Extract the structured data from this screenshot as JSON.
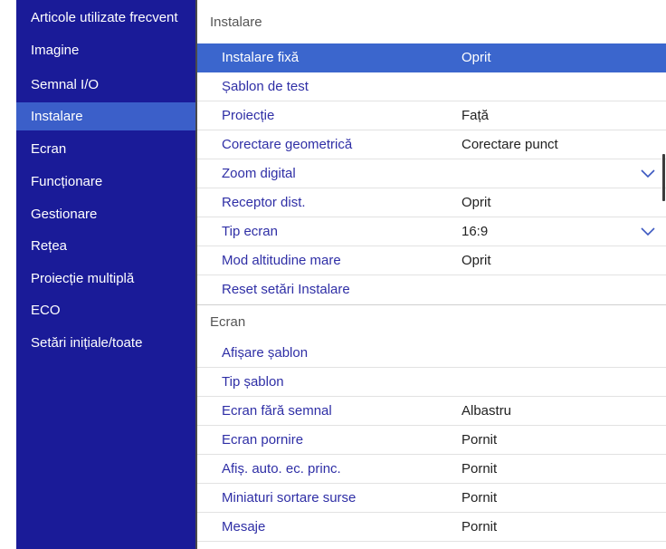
{
  "sidebar": {
    "items": [
      {
        "label": "Articole utilizate frecvent"
      },
      {
        "label": "Imagine"
      },
      {
        "label": "Semnal I/O"
      },
      {
        "label": "Instalare"
      },
      {
        "label": "Ecran"
      },
      {
        "label": "Funcționare"
      },
      {
        "label": "Gestionare"
      },
      {
        "label": "Rețea"
      },
      {
        "label": "Proiecție multiplă"
      },
      {
        "label": "ECO"
      },
      {
        "label": "Setări inițiale/toate"
      }
    ],
    "active_item": "Instalare"
  },
  "sections": [
    {
      "title": "Instalare",
      "rows": [
        {
          "label": "Instalare fixă",
          "value": "Oprit"
        },
        {
          "label": "Șablon de test",
          "value": ""
        },
        {
          "label": "Proiecție",
          "value": "Față"
        },
        {
          "label": "Corectare geometrică",
          "value": "Corectare punct"
        },
        {
          "label": "Zoom digital",
          "value": ""
        },
        {
          "label": "Receptor dist.",
          "value": "Oprit"
        },
        {
          "label": "Tip ecran",
          "value": "16:9"
        },
        {
          "label": "Mod altitudine mare",
          "value": "Oprit"
        },
        {
          "label": "Reset setări Instalare",
          "value": ""
        }
      ]
    },
    {
      "title": "Ecran",
      "rows": [
        {
          "label": "Afișare șablon",
          "value": ""
        },
        {
          "label": "Tip șablon",
          "value": ""
        },
        {
          "label": "Ecran fără semnal",
          "value": "Albastru"
        },
        {
          "label": "Ecran pornire",
          "value": "Pornit"
        },
        {
          "label": "Afiș. auto. ec. princ.",
          "value": "Pornit"
        },
        {
          "label": "Miniaturi sortare surse",
          "value": "Pornit"
        },
        {
          "label": "Mesaje",
          "value": "Pornit"
        }
      ]
    }
  ],
  "selected_row": "Instalare fixă",
  "icons": {
    "dropdown": "chevron-down-icon"
  },
  "colors": {
    "sidebar_bg": "#1a1b98",
    "sidebar_active": "#3b5fc9",
    "row_selected": "#3b66cd",
    "row_label": "#2f2fa6"
  }
}
